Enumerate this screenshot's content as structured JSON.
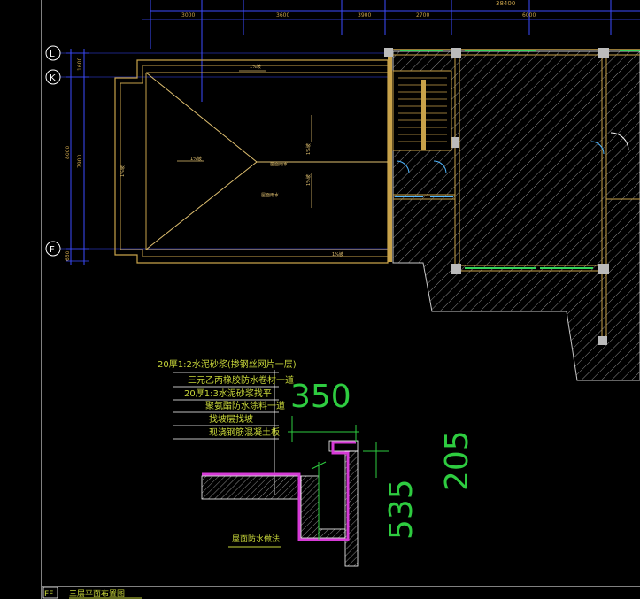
{
  "colors": {
    "background": "#000000",
    "dimension": "#3b4bff",
    "wall": "#c8a24a",
    "wall_light": "#e0c070",
    "window": "#35d35a",
    "hatch": "#c7c7c7",
    "note_text": "#c8d63a",
    "leader": "#ffffff",
    "detail_dim": "#2ecc40",
    "membrane": "#d63ad6",
    "door": "#4fb6ff"
  },
  "top_dimension": {
    "overall": "38400",
    "segments": [
      "3000",
      "3600",
      "3900",
      "2700",
      "6000"
    ]
  },
  "grid_axes": [
    "L",
    "K",
    "F"
  ],
  "left_dimensions": [
    "1600",
    "8000",
    "7900",
    "650"
  ],
  "roof_plan": {
    "slope_labels": [
      "1%坡",
      "1%坡",
      "1%坡",
      "1%坡",
      "1%坡",
      "1%坡"
    ],
    "center_label": "屋面雨水",
    "note": "屋面雨水"
  },
  "detail": {
    "layers": [
      "20厚1:2水泥砂浆(掺钢丝网片一层)",
      "三元乙丙橡胶防水卷材一道",
      "20厚1:3水泥砂浆找平",
      "聚氨酯防水涂料一道",
      "找坡层找坡",
      "现浇钢筋混凝土板"
    ],
    "dims": [
      "350",
      "205",
      "535"
    ],
    "caption": "屋面防水做法"
  },
  "status_bar": {
    "tag": "FF",
    "title": "三层平面布置图"
  }
}
